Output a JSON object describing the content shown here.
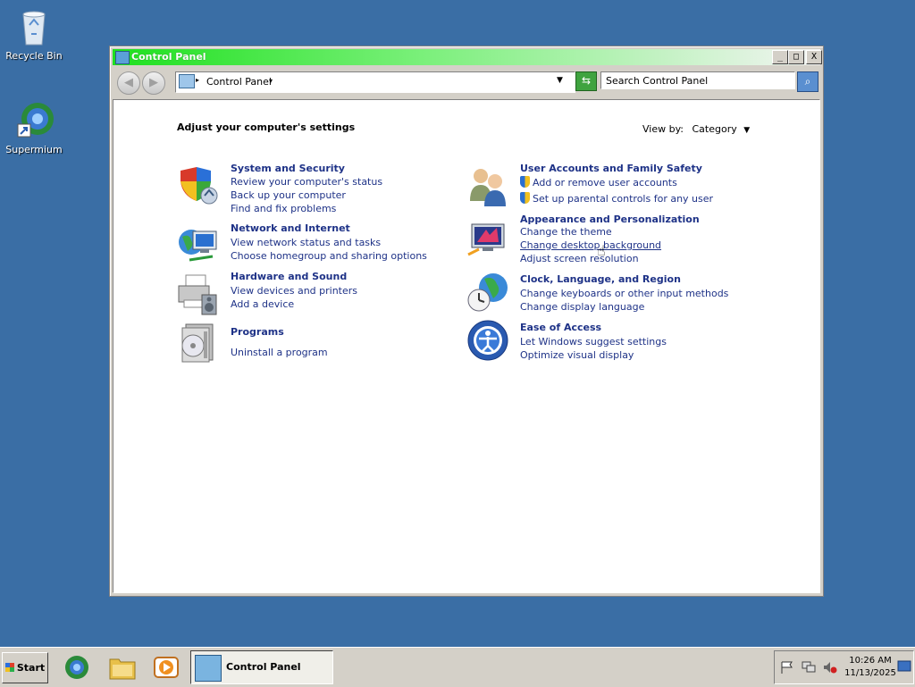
{
  "desktop": {
    "icons": [
      {
        "label": "Recycle Bin"
      },
      {
        "label": "Supermium"
      }
    ]
  },
  "window": {
    "title": "Control Panel",
    "controls": {
      "minimize": "_",
      "maximize": "□",
      "close": "X"
    },
    "address": {
      "path": "Control Panel"
    },
    "search": {
      "placeholder": "Search Control Panel"
    }
  },
  "content": {
    "heading": "Adjust your computer's settings",
    "view_by": {
      "label": "View by:",
      "value": "Category"
    },
    "categories": [
      {
        "title": "System and Security",
        "icon": "security-shield-icon",
        "links": [
          "Review your computer's status",
          "Back up your computer",
          "Find and fix problems"
        ]
      },
      {
        "title": "Network and Internet",
        "icon": "network-globe-icon",
        "links": [
          "View network status and tasks",
          "Choose homegroup and sharing options"
        ]
      },
      {
        "title": "Hardware and Sound",
        "icon": "printer-icon",
        "links": [
          "View devices and printers",
          "Add a device"
        ]
      },
      {
        "title": "Programs",
        "icon": "programs-disc-icon",
        "links": [
          "Uninstall a program"
        ]
      },
      {
        "title": "User Accounts and Family Safety",
        "icon": "users-icon",
        "links": [
          "Add or remove user accounts",
          "Set up parental controls for any user"
        ]
      },
      {
        "title": "Appearance and Personalization",
        "icon": "monitor-paint-icon",
        "links": [
          "Change the theme",
          "Change desktop background",
          "Adjust screen resolution"
        ]
      },
      {
        "title": "Clock, Language, and Region",
        "icon": "clock-globe-icon",
        "links": [
          "Change keyboards or other input methods",
          "Change display language"
        ]
      },
      {
        "title": "Ease of Access",
        "icon": "ease-of-access-icon",
        "links": [
          "Let Windows suggest settings",
          "Optimize visual display"
        ]
      }
    ]
  },
  "taskbar": {
    "start_label": "Start",
    "active_task": "Control Panel",
    "clock": {
      "time": "10:26 AM",
      "date": "11/13/2025"
    }
  },
  "colors": {
    "desktop": "#3a6ea5",
    "link": "#1e3287",
    "titlebar_green": "#1ee01e"
  }
}
